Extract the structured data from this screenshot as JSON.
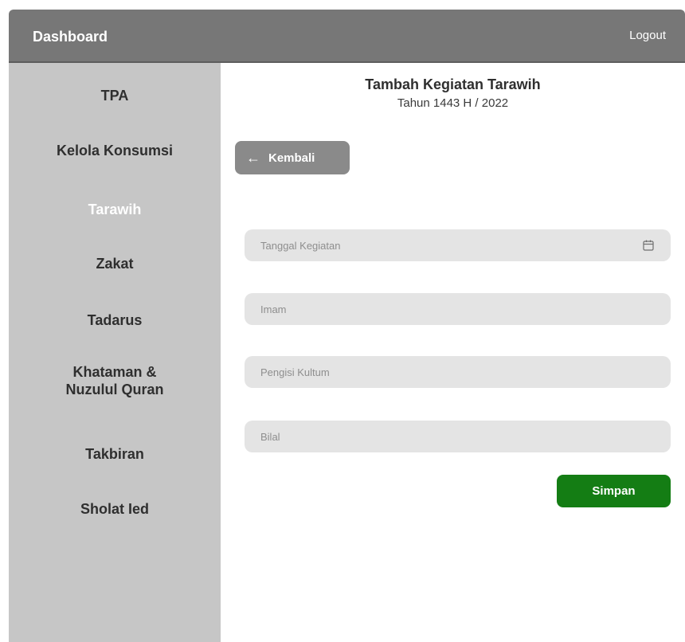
{
  "header": {
    "brand": "Dashboard",
    "logout_label": "Logout"
  },
  "sidebar": {
    "items": [
      {
        "label": "TPA"
      },
      {
        "label": "Kelola Konsumsi"
      },
      {
        "label": "Tarawih",
        "active": true
      },
      {
        "label": "Zakat"
      },
      {
        "label": "Tadarus"
      },
      {
        "label_lines": [
          "Khataman &",
          "Nuzulul Quran"
        ]
      },
      {
        "label": "Takbiran"
      },
      {
        "label": "Sholat Ied"
      }
    ]
  },
  "main": {
    "title": "Tambah Kegiatan Tarawih",
    "subtitle": "Tahun 1443 H / 2022",
    "back_label": "Kembali",
    "fields": {
      "tanggal": {
        "placeholder": "Tanggal Kegiatan",
        "value": ""
      },
      "imam": {
        "placeholder": "Imam",
        "value": ""
      },
      "kultum": {
        "placeholder": "Pengisi Kultum",
        "value": ""
      },
      "bilal": {
        "placeholder": "Bilal",
        "value": ""
      }
    },
    "save_label": "Simpan"
  },
  "icons": {
    "back": "arrow-left-icon",
    "date": "calendar-icon"
  },
  "colors": {
    "header": "#777777",
    "sidebar": "#c6c6c6",
    "back_button": "#8a8a8a",
    "save_button": "#147d14",
    "field_bg": "#e4e4e4"
  }
}
